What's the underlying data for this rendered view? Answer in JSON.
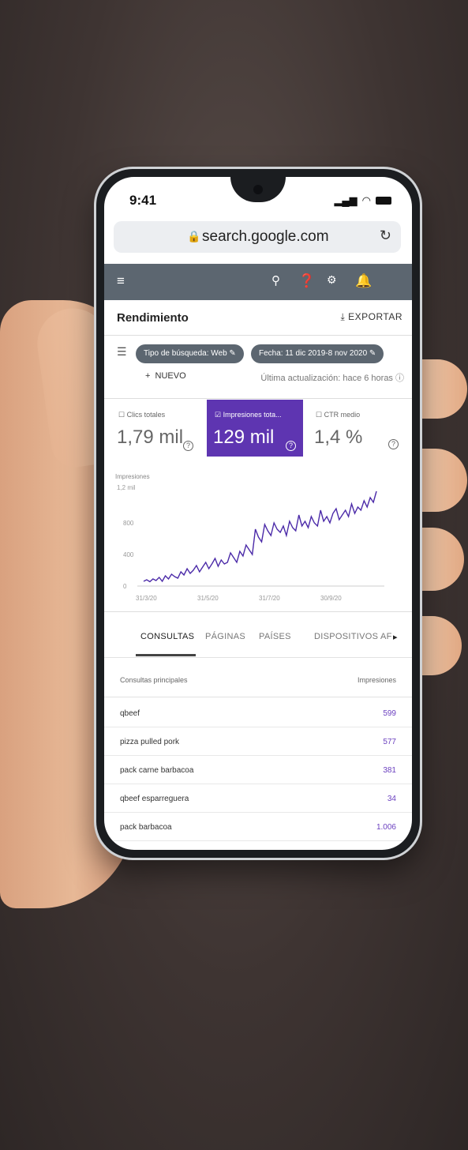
{
  "status_bar": {
    "time": "9:41"
  },
  "browser": {
    "url": "search.google.com"
  },
  "page": {
    "title": "Rendimiento",
    "export_label": "EXPORTAR"
  },
  "filters": {
    "search_type": "Tipo de búsqueda: Web",
    "date": "Fecha: 11 dic 2019-8 nov 2020",
    "new_label": "NUEVO",
    "last_update": "Última actualización: hace 6 horas"
  },
  "metrics": [
    {
      "label": "Clics totales",
      "value": "1,79 mil",
      "selected": false
    },
    {
      "label": "Impresiones tota...",
      "value": "129 mil",
      "selected": true
    },
    {
      "label": "CTR medio",
      "value": "1,4 %",
      "selected": false
    }
  ],
  "colors": {
    "accent": "#5e35b1",
    "toolbar": "#5c6670",
    "line": "#4b2aa8"
  },
  "chart_data": {
    "type": "line",
    "ylabel": "Impresiones",
    "yticks": [
      "0",
      "400",
      "800",
      "1,2 mil"
    ],
    "ylim": [
      0,
      1200
    ],
    "xticks": [
      "31/3/20",
      "31/5/20",
      "31/7/20",
      "30/9/20"
    ],
    "series": [
      {
        "values": [
          60,
          80,
          55,
          90,
          70,
          110,
          60,
          130,
          90,
          150,
          120,
          100,
          180,
          140,
          220,
          160,
          200,
          260,
          180,
          240,
          300,
          220,
          280,
          350,
          250,
          330,
          280,
          300,
          420,
          360,
          300,
          440,
          380,
          520,
          460,
          400,
          720,
          620,
          560,
          780,
          700,
          640,
          800,
          720,
          680,
          760,
          640,
          820,
          740,
          700,
          900,
          760,
          820,
          740,
          880,
          800,
          760,
          960,
          820,
          880,
          800,
          920,
          980,
          840,
          900,
          960,
          880,
          1040,
          920,
          1000,
          960,
          1080,
          1000,
          1120,
          1060,
          1200
        ]
      }
    ]
  },
  "tabs": [
    "CONSULTAS",
    "PÁGINAS",
    "PAÍSES",
    "DISPOSITIVOS AF"
  ],
  "table": {
    "header_query": "Consultas principales",
    "header_impressions": "Impresiones",
    "rows": [
      {
        "query": "qbeef",
        "impressions": "599"
      },
      {
        "query": "pizza pulled pork",
        "impressions": "577"
      },
      {
        "query": "pack carne barbacoa",
        "impressions": "381"
      },
      {
        "query": "qbeef esparreguera",
        "impressions": "34"
      },
      {
        "query": "pack barbacoa",
        "impressions": "1.006"
      }
    ]
  }
}
